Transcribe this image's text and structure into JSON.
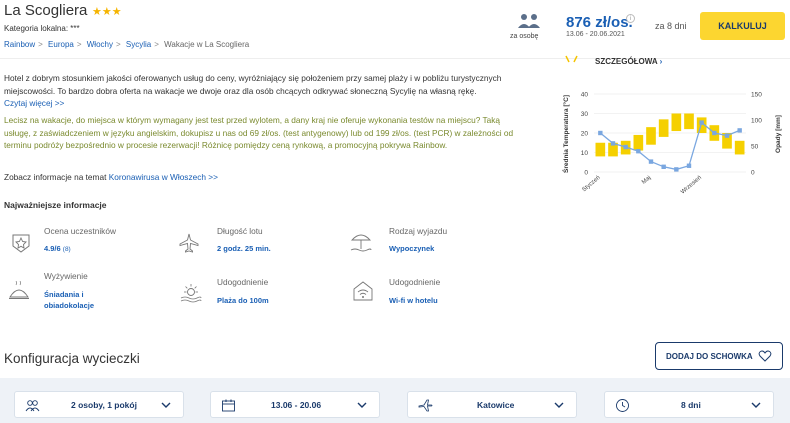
{
  "header": {
    "title": "La Scogliera",
    "stars": "★★★",
    "category": "Kategoria lokalna: ***",
    "breadcrumb": [
      "Rainbow",
      "Europa",
      "Włochy",
      "Sycylia",
      "Wakacje w La Scogliera"
    ],
    "persons_label": "za osobę",
    "price": "876 zł/os.",
    "dates": "13.06 - 20.06.2021",
    "for_days": "za 8 dni",
    "calc_label": "KALKULUJ"
  },
  "description": {
    "text": "Hotel z dobrym stosunkiem jakości oferowanych usług do ceny, wyróżniający się położeniem przy samej plaży i w pobliżu turystycznych miejscowości. To bardzo dobra oferta na wakacje we dwoje oraz dla osób chcących odkrywać słoneczną Sycylię na własną rękę.",
    "read_more": "Czytaj więcej >>",
    "promo": "Lecisz na wakacje, do miejsca w którym wymagany jest test przed wylotem, a dany kraj nie oferuje wykonania testów na miejscu? Taką usługę, z zaświadczeniem w języku angielskim, dokupisz u nas od 69 zł/os. (test antygenowy) lub od 199 zł/os. (test PCR) w zależności od terminu podróży bezpośrednio w procesie rezerwacji! Różnicę pomiędzy ceną rynkową, a promocyjną pokrywa Rainbow.",
    "covid_prefix": "Zobacz informacje na temat",
    "covid_link": "Koronawirusa w Włoszech >>"
  },
  "key_info": {
    "title": "Najważniejsze informacje",
    "items": [
      {
        "label": "Ocena uczestników",
        "value": "4.9/6",
        "extra": "(8)",
        "icon": "rating-star-icon"
      },
      {
        "label": "Długość lotu",
        "value": "2 godz. 25 min.",
        "icon": "plane-icon"
      },
      {
        "label": "Rodzaj wyjazdu",
        "value": "Wypoczynek",
        "icon": "beach-umbrella-icon"
      },
      {
        "label": "Wyżywienie",
        "value": "Śniadania i obiadokolacje",
        "icon": "food-dish-icon"
      },
      {
        "label": "Udogodnienie",
        "value": "Plaża do 100m",
        "icon": "beach-sun-icon"
      },
      {
        "label": "Udogodnienie",
        "value": "Wi-fi w hotelu",
        "icon": "wifi-icon"
      }
    ]
  },
  "details_link": "SZCZEGÓŁOWA",
  "chart_data": {
    "type": "bar",
    "ylabel_left": "Średnia Temperatura [°C]",
    "ylabel_right": "Opady [mm]",
    "ylim_left": [
      0,
      40
    ],
    "ylim_right": [
      0,
      150
    ],
    "yticks_left": [
      "0",
      "10",
      "20",
      "30",
      "40"
    ],
    "yticks_right": [
      "0",
      "50",
      "100",
      "150"
    ],
    "x_labels": [
      "Styczeń",
      "Maj",
      "Wrzesień"
    ],
    "x_label_months": [
      1,
      5,
      9
    ],
    "months": [
      1,
      2,
      3,
      4,
      5,
      6,
      7,
      8,
      9,
      10,
      11,
      12
    ],
    "temperature_ranges": [
      [
        8,
        15
      ],
      [
        8,
        15
      ],
      [
        9,
        16
      ],
      [
        11,
        19
      ],
      [
        14,
        23
      ],
      [
        18,
        27
      ],
      [
        21,
        30
      ],
      [
        22,
        30
      ],
      [
        20,
        28
      ],
      [
        16,
        24
      ],
      [
        12,
        20
      ],
      [
        9,
        16
      ]
    ],
    "precipitation": [
      75,
      55,
      48,
      40,
      20,
      10,
      5,
      12,
      95,
      75,
      70,
      80
    ],
    "bar_color": "#f5d000",
    "line_color": "#7aa7e0"
  },
  "config": {
    "title": "Konfiguracja wycieczki",
    "clipboard_label": "DODAJ DO SCHOWKA",
    "selects": [
      {
        "value": "2 osoby, 1 pokój",
        "icon": "people-icon"
      },
      {
        "value": "13.06 - 20.06",
        "icon": "calendar-icon"
      },
      {
        "value": "Katowice",
        "icon": "plane-icon"
      },
      {
        "value": "8 dni",
        "icon": "clock-icon"
      }
    ]
  }
}
